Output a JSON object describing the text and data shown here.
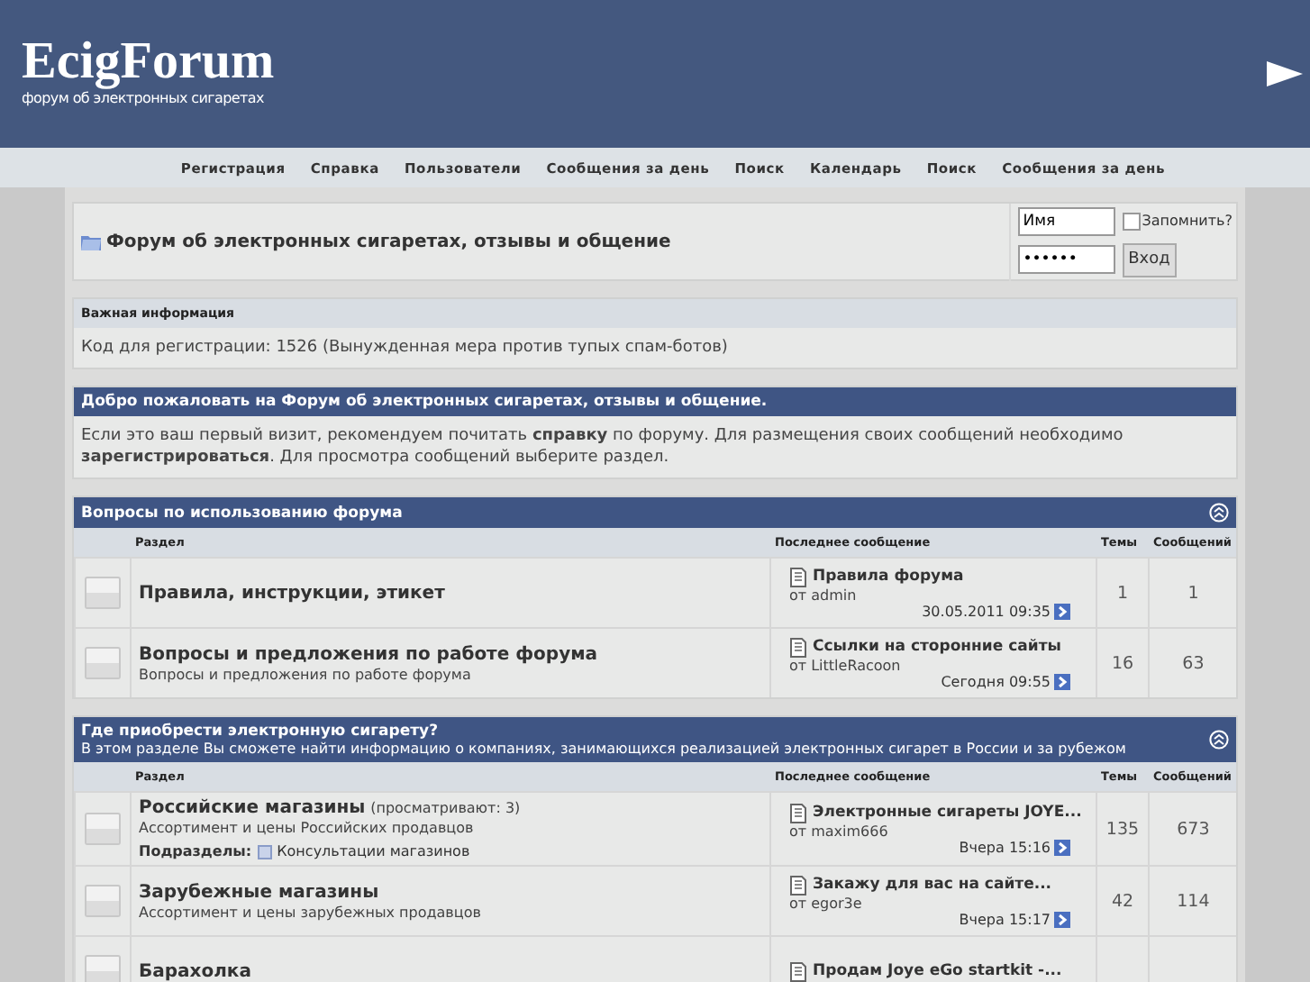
{
  "header": {
    "logo_title": "EcigForum",
    "logo_subtitle": "форум об электронных сигаретах"
  },
  "nav": [
    "Регистрация",
    "Справка",
    "Пользователи",
    "Сообщения за день",
    "Поиск",
    "Календарь",
    "Поиск",
    "Сообщения за день"
  ],
  "forum_bar": {
    "title": "Форум об электронных сигаретах, отзывы и общение",
    "login": {
      "username": "Имя",
      "password": "••••••",
      "remember_label": "Запомнить?",
      "remember_checked": false,
      "button": "Вход"
    }
  },
  "notice": {
    "heading": "Важная информация",
    "text": "Код для регистрации: 1526 (Вынужденная мера против тупых спам-ботов)"
  },
  "welcome": {
    "heading": "Добро пожаловать на Форум об электронных сигаретах, отзывы и общение.",
    "text": "Если это ваш первый визит, рекомендуем почитать **справку** по форуму. Для размещения своих сообщений необходимо **зарегистрироваться**. Для просмотра сообщений выберите раздел."
  },
  "categories": [
    {
      "title": "Вопросы по использованию форума",
      "columns": [
        "Раздел",
        "Последнее сообщение",
        "Темы",
        "Сообщений"
      ],
      "forums": [
        {
          "name": "Правила, инструкции, этикет",
          "last_post": {
            "title": "Правила форума",
            "author": "от admin",
            "time": "30.05.2011 09:35"
          },
          "topics": "1",
          "posts": "1"
        },
        {
          "name": "Вопросы и предложения по работе форума",
          "description": "Вопросы и предложения по работе форума",
          "last_post": {
            "title": "Ссылки на сторонние сайты",
            "author": "от LittleRacoon",
            "time": "Сегодня 09:55"
          },
          "topics": "16",
          "posts": "63"
        }
      ]
    },
    {
      "title": "Где приобрести электронную сигарету?",
      "description": "В этом разделе Вы сможете найти информацию о компаниях, занимающихся реализацией электронных сигарет в России и за рубежом",
      "columns": [
        "Раздел",
        "Последнее сообщение",
        "Темы",
        "Сообщений"
      ],
      "forums": [
        {
          "name": "Российские магазины",
          "viewing": "(просматривают: 3)",
          "description": "Ассортимент и цены Российских продавцов",
          "subforums_label": "Подразделы:",
          "subforums": [
            "Консультации магазинов"
          ],
          "last_post": {
            "title": "Электронные сигареты JOYE...",
            "author": "от maxim666",
            "time": "Вчера 15:16"
          },
          "topics": "135",
          "posts": "673"
        },
        {
          "name": "Зарубежные магазины",
          "description": "Ассортимент и цены зарубежных продавцов",
          "last_post": {
            "title": "Закажу для вас на сайте...",
            "author": "от egor3e",
            "time": "Вчера 15:17"
          },
          "topics": "42",
          "posts": "114"
        },
        {
          "name": "Барахолка",
          "last_post": {
            "title": "Продам Joye eGo startkit -..."
          }
        }
      ]
    }
  ]
}
